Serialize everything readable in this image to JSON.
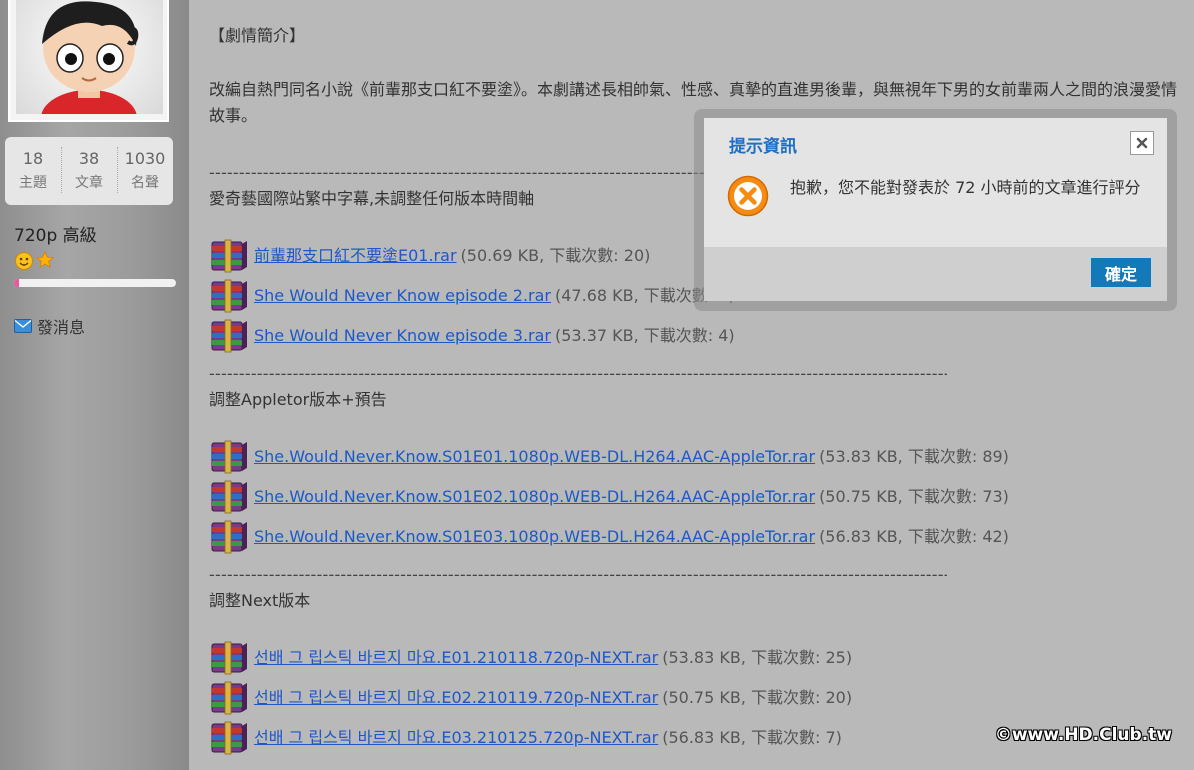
{
  "sidebar": {
    "stats": [
      {
        "num": "18",
        "label": "主題"
      },
      {
        "num": "38",
        "label": "文章"
      },
      {
        "num": "1030",
        "label": "名聲"
      }
    ],
    "rank": "720p 高級",
    "progress_fraction": 0.03,
    "send_message": "發消息"
  },
  "post": {
    "heading": "【劇情簡介】",
    "synopsis": "改編自熱門同名小說《前輩那支口紅不要塗》。本劇講述長相帥氣、性感、真摯的直進男後輩，與無視年下男的女前輩兩人之間的浪漫愛情故事。",
    "separator": "----------------------------------------------------------------------------------------------------------------------------------------",
    "section1": "愛奇藝國際站繁中字幕,未調整任何版本時間軸",
    "section2": "調整Appletor版本+預告",
    "section3": "調整Next版本",
    "attachments1": [
      {
        "name": "前輩那支口紅不要塗E01.rar",
        "meta": "(50.69 KB, 下載次數: 20)"
      },
      {
        "name": "She Would Never Know episode 2.rar",
        "meta": "(47.68 KB, 下載次數: 6)"
      },
      {
        "name": "She Would Never Know episode 3.rar",
        "meta": "(53.37 KB, 下載次數: 4)"
      }
    ],
    "attachments2": [
      {
        "name": "She.Would.Never.Know.S01E01.1080p.WEB-DL.H264.AAC-AppleTor.rar",
        "meta": "(53.83 KB, 下載次數: 89)"
      },
      {
        "name": "She.Would.Never.Know.S01E02.1080p.WEB-DL.H264.AAC-AppleTor.rar",
        "meta": "(50.75 KB, 下載次數: 73)"
      },
      {
        "name": "She.Would.Never.Know.S01E03.1080p.WEB-DL.H264.AAC-AppleTor.rar",
        "meta": "(56.83 KB, 下載次數: 42)"
      }
    ],
    "attachments3": [
      {
        "name": "선배 그 립스틱 바르지 마요.E01.210118.720p-NEXT.rar",
        "meta": "(53.83 KB, 下載次數: 25)"
      },
      {
        "name": "선배 그 립스틱 바르지 마요.E02.210119.720p-NEXT.rar",
        "meta": "(50.75 KB, 下載次數: 20)"
      },
      {
        "name": "선배 그 립스틱 바르지 마요.E03.210125.720p-NEXT.rar",
        "meta": "(56.83 KB, 下載次數: 7)"
      }
    ]
  },
  "dialog": {
    "title": "提示資訊",
    "message": "抱歉，您不能對發表於 72 小時前的文章進行評分",
    "ok_label": "確定"
  },
  "watermark": "©www.HD.Club.tw",
  "colors": {
    "link": "#1f57c8",
    "dialog_title": "#1f6fc4",
    "ok_button": "#1479b8",
    "progress": "#e85aa0"
  }
}
